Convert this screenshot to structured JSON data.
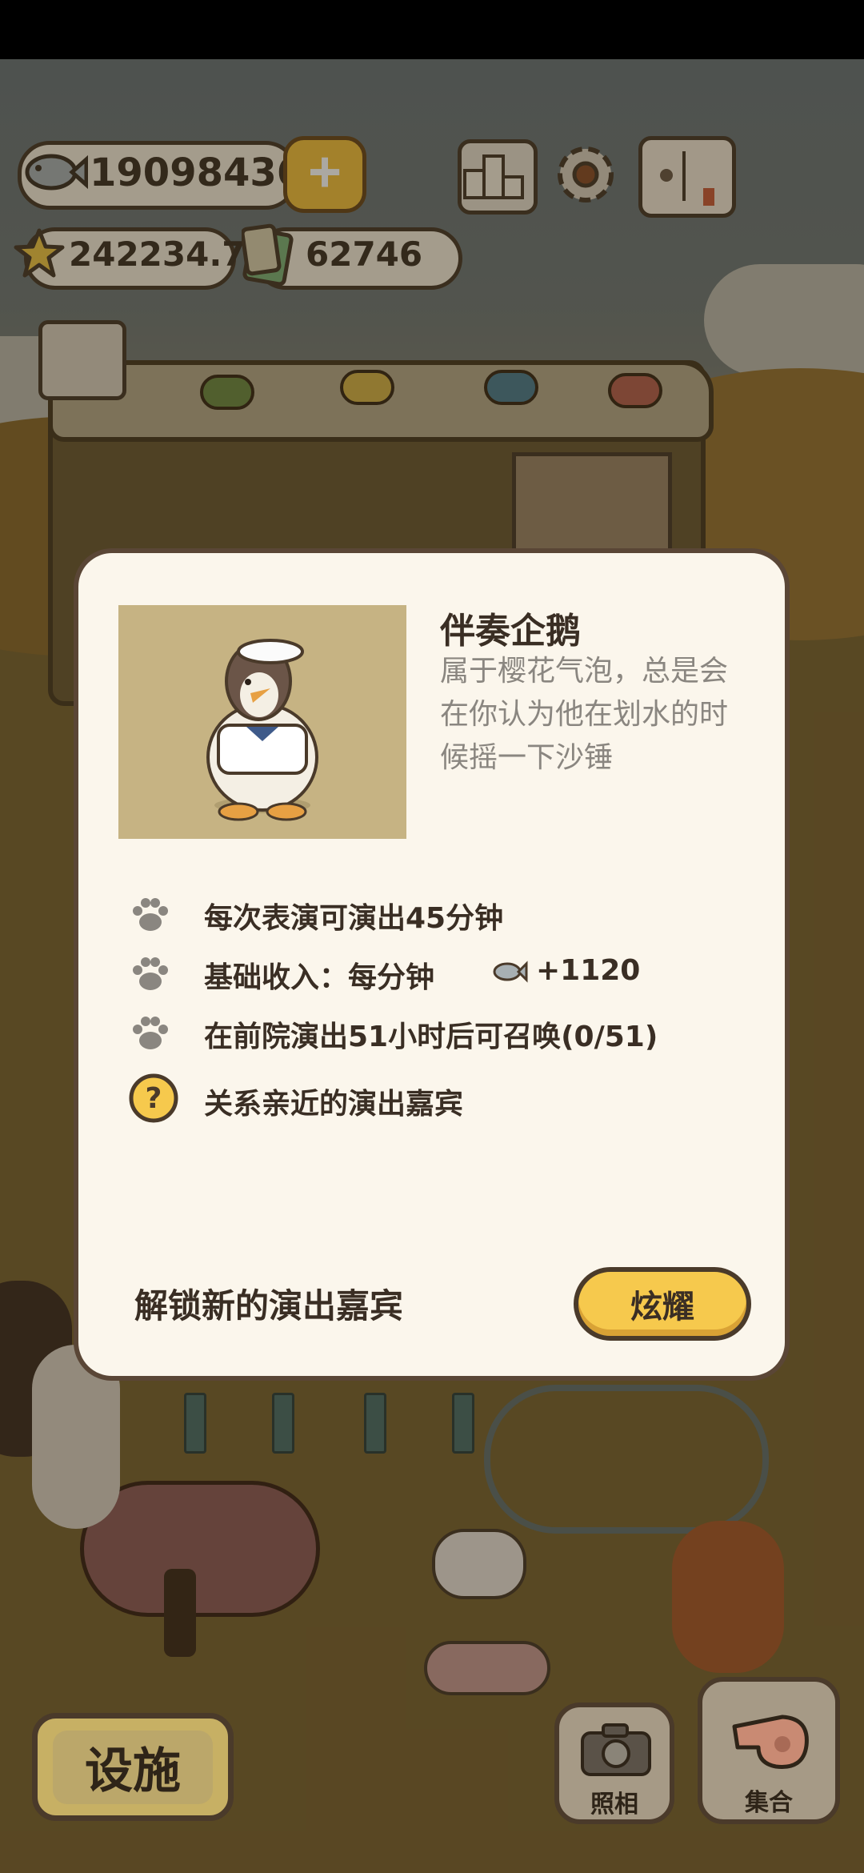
{
  "hud": {
    "fish_count": "19098436",
    "star_count": "242234.7",
    "ticket_count": "62746"
  },
  "popup": {
    "title": "伴奏企鹅",
    "description": "属于樱花气泡，总是会在你认为他在划水的时候摇一下沙锤",
    "details": [
      {
        "icon": "paw-icon",
        "text": "每次表演可演出45分钟"
      },
      {
        "icon": "paw-icon",
        "text": "基础收入：每分钟",
        "suffix": "+1120"
      },
      {
        "icon": "paw-icon",
        "text": "在前院演出51小时后可召唤(0/51)"
      },
      {
        "icon": "question-icon",
        "text": "关系亲近的演出嘉宾"
      }
    ],
    "unlock_label": "解锁新的演出嘉宾",
    "show_button": "炫耀"
  },
  "bottom": {
    "facilities_button": "设施",
    "photo_button": "照相",
    "gather_button": "集合"
  },
  "colors": {
    "modal_bg": "#fbf6ec",
    "border": "#4a3a2a",
    "accent_yellow": "#f6c94d",
    "portrait_bg": "#c6b383"
  }
}
